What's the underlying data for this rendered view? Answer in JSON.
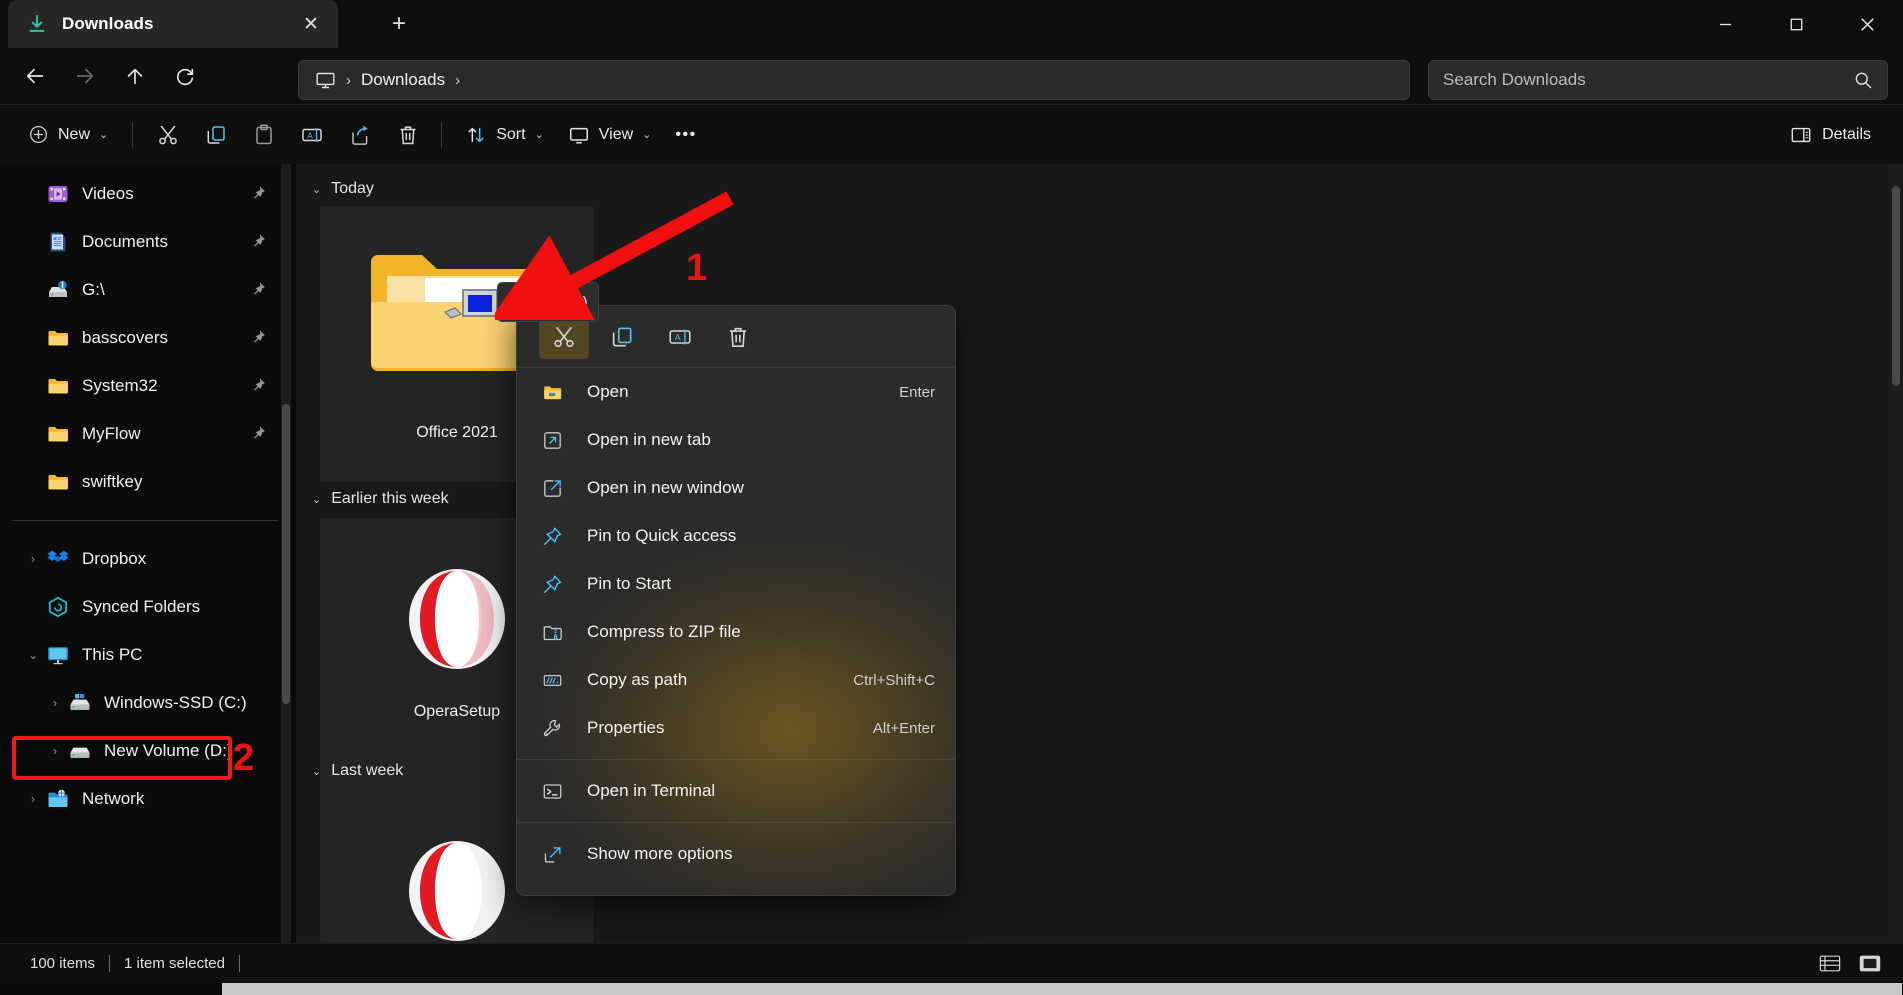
{
  "window": {
    "tab_title": "Downloads",
    "tab_icon": "download-icon",
    "close_label": "✕",
    "newtab_label": "+",
    "minimize_label": "—",
    "maximize_label": "❐",
    "window_close_label": "✕"
  },
  "nav": {
    "back": "←",
    "forward": "→",
    "up": "↑",
    "refresh": "⟳",
    "breadcrumb": {
      "root_icon": "monitor-icon",
      "sep1": "›",
      "current": "Downloads",
      "sep2": "›"
    },
    "search": {
      "placeholder": "Search Downloads",
      "value": "",
      "icon": "search-icon"
    }
  },
  "toolbar": {
    "new_label": "New",
    "new_chevron": "⌄",
    "cut_icon": "scissors-icon",
    "copy_icon": "copy-icon",
    "paste_icon": "paste-icon",
    "rename_icon": "rename-icon",
    "share_icon": "share-icon",
    "delete_icon": "trash-icon",
    "sort_label": "Sort",
    "sort_chevron": "⌄",
    "view_label": "View",
    "view_chevron": "⌄",
    "more_label": "•••",
    "details_label": "Details",
    "details_icon": "details-pane-icon"
  },
  "sidebar": {
    "items": [
      {
        "label": "Videos",
        "icon": "videos-icon",
        "pinned": true,
        "expander": ""
      },
      {
        "label": "Documents",
        "icon": "documents-icon",
        "pinned": true,
        "expander": ""
      },
      {
        "label": "G:\\",
        "icon": "network-drive-icon",
        "pinned": true,
        "expander": ""
      },
      {
        "label": "basscovers",
        "icon": "folder-icon",
        "pinned": true,
        "expander": ""
      },
      {
        "label": "System32",
        "icon": "folder-icon",
        "pinned": true,
        "expander": ""
      },
      {
        "label": "MyFlow",
        "icon": "folder-icon",
        "pinned": true,
        "expander": ""
      },
      {
        "label": "swiftkey",
        "icon": "folder-icon",
        "pinned": false,
        "expander": ""
      }
    ],
    "tree": [
      {
        "label": "Dropbox",
        "icon": "dropbox-icon",
        "expander": "›",
        "indent": 0,
        "highlighted": false
      },
      {
        "label": "Synced Folders",
        "icon": "synced-folders-icon",
        "expander": "",
        "indent": 0,
        "highlighted": false
      },
      {
        "label": "This PC",
        "icon": "this-pc-icon",
        "expander": "⌄",
        "indent": 0,
        "highlighted": false
      },
      {
        "label": "Windows-SSD (C:)",
        "icon": "windows-drive-icon",
        "expander": "›",
        "indent": 1,
        "highlighted": true
      },
      {
        "label": "New Volume (D:)",
        "icon": "drive-icon",
        "expander": "›",
        "indent": 1,
        "highlighted": false
      },
      {
        "label": "Network",
        "icon": "network-icon",
        "expander": "›",
        "indent": 0,
        "highlighted": false
      }
    ]
  },
  "content": {
    "groups": [
      {
        "label": "Today",
        "chevron": "⌄"
      },
      {
        "label": "Earlier this week",
        "chevron": "⌄"
      },
      {
        "label": "Last week",
        "chevron": "⌄"
      }
    ],
    "tiles": [
      {
        "label": "Office 2021",
        "icon": "folder-shortcut-icon",
        "group": "Today"
      },
      {
        "label": "OperaSetup",
        "icon": "opera-icon",
        "group": "Earlier this week"
      }
    ]
  },
  "tooltip": {
    "text": "Cut (Ctrl+X)"
  },
  "annotations": [
    {
      "id": "1",
      "label": "1",
      "target": "cut-button"
    },
    {
      "id": "2",
      "label": "2",
      "target": "sidebar-item-windows-ssd"
    }
  ],
  "context_menu": {
    "top_actions": [
      {
        "name": "cut-button",
        "icon": "scissors-icon",
        "active": true
      },
      {
        "name": "copy-button",
        "icon": "copy-icon",
        "active": false
      },
      {
        "name": "rename-button",
        "icon": "rename-icon",
        "active": false
      },
      {
        "name": "delete-button",
        "icon": "trash-icon",
        "active": false
      }
    ],
    "items": [
      {
        "label": "Open",
        "accel": "Enter",
        "icon": "folder-icon",
        "sep_after": false
      },
      {
        "label": "Open in new tab",
        "accel": "",
        "icon": "new-tab-icon",
        "sep_after": false
      },
      {
        "label": "Open in new window",
        "accel": "",
        "icon": "new-window-icon",
        "sep_after": false
      },
      {
        "label": "Pin to Quick access",
        "accel": "",
        "icon": "pin-icon",
        "sep_after": false
      },
      {
        "label": "Pin to Start",
        "accel": "",
        "icon": "pin-icon",
        "sep_after": false
      },
      {
        "label": "Compress to ZIP file",
        "accel": "",
        "icon": "zip-icon",
        "sep_after": false
      },
      {
        "label": "Copy as path",
        "accel": "Ctrl+Shift+C",
        "icon": "copy-path-icon",
        "sep_after": false
      },
      {
        "label": "Properties",
        "accel": "Alt+Enter",
        "icon": "wrench-icon",
        "sep_after": true
      },
      {
        "label": "Open in Terminal",
        "accel": "",
        "icon": "terminal-icon",
        "sep_after": true
      },
      {
        "label": "Show more options",
        "accel": "",
        "icon": "more-options-icon",
        "sep_after": false
      }
    ]
  },
  "statusbar": {
    "item_count": "100 items",
    "selection": "1 item selected",
    "list_view_icon": "list-view-icon",
    "grid_view_icon": "grid-view-icon"
  },
  "colors": {
    "accent_blue": "#4cc2ff",
    "annotation_red": "#e81414",
    "folder_yellow": "#ffca3a",
    "menu_glow": "#96730c"
  }
}
